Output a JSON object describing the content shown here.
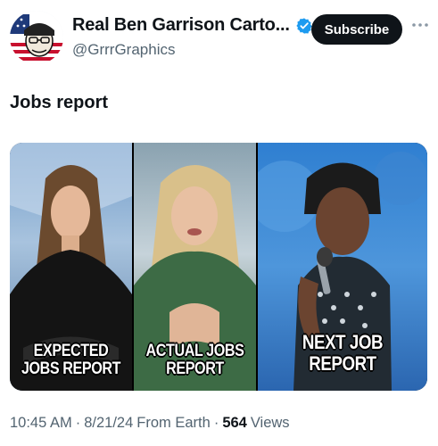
{
  "author": {
    "display_name": "Real Ben Garrison Carto...",
    "handle": "@GrrrGraphics",
    "verified": true,
    "verified_color": "#1d9bf0",
    "avatar_icon": "cartoon-avatar-with-flag"
  },
  "actions": {
    "subscribe_label": "Subscribe",
    "more_icon": "more-horizontal-icon"
  },
  "post": {
    "text": "Jobs report",
    "media": {
      "panels": [
        {
          "caption": "EXPECTED\nJOBS REPORT"
        },
        {
          "caption": "ACTUAL JOBS\nREPORT"
        },
        {
          "caption": "NEXT JOB\nREPORT"
        }
      ]
    }
  },
  "meta": {
    "time": "10:45 AM",
    "date": "8/21/24",
    "source": "From Earth",
    "views_count": "564",
    "views_label": "Views"
  }
}
